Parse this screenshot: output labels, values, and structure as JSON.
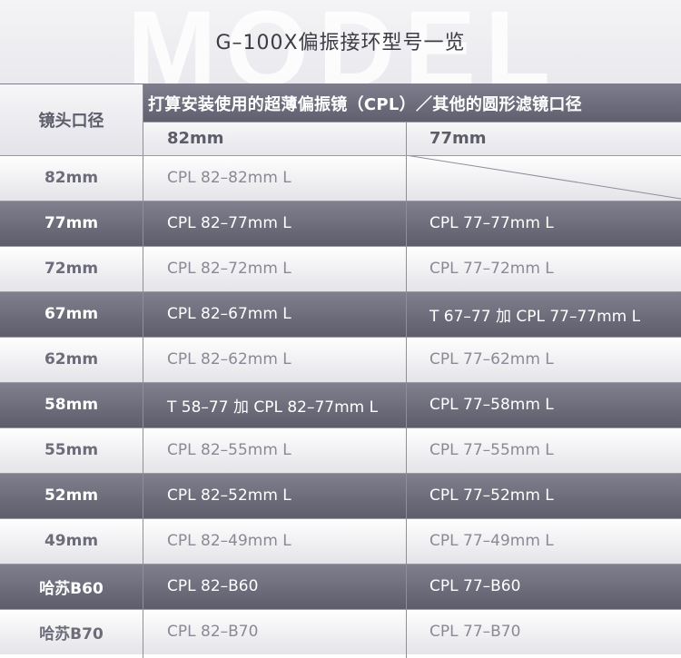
{
  "header": {
    "watermark": "MODEL",
    "title": "G–100X偏振接环型号一览"
  },
  "columns": {
    "lens_diameter": "镜头口径",
    "cpl_heading": "打算安装使用的超薄偏振镜（CPL）／其他的圆形滤镜口径",
    "size_82": "82mm",
    "size_77": "77mm"
  },
  "rows": [
    {
      "size": "82mm",
      "cpl82": "CPL 82–82mm L",
      "cpl77": "",
      "shade": "light"
    },
    {
      "size": "77mm",
      "cpl82": "CPL 82–77mm L",
      "cpl77": "CPL 77–77mm L",
      "shade": "dark"
    },
    {
      "size": "72mm",
      "cpl82": "CPL 82–72mm L",
      "cpl77": "CPL 77–72mm L",
      "shade": "light"
    },
    {
      "size": "67mm",
      "cpl82": "CPL 82–67mm L",
      "cpl77": "T 67–77 加 CPL 77–77mm L",
      "shade": "dark"
    },
    {
      "size": "62mm",
      "cpl82": "CPL 82–62mm L",
      "cpl77": "CPL 77–62mm L",
      "shade": "light"
    },
    {
      "size": "58mm",
      "cpl82": "T 58–77 加 CPL 82–77mm L",
      "cpl77": "CPL 77–58mm L",
      "shade": "dark"
    },
    {
      "size": "55mm",
      "cpl82": "CPL 82–55mm L",
      "cpl77": "CPL 77–55mm L",
      "shade": "light"
    },
    {
      "size": "52mm",
      "cpl82": "CPL 82–52mm L",
      "cpl77": "CPL 77–52mm L",
      "shade": "dark"
    },
    {
      "size": "49mm",
      "cpl82": "CPL 82–49mm L",
      "cpl77": "CPL 77–49mm L",
      "shade": "light"
    },
    {
      "size": "哈苏B60",
      "cpl82": "CPL 82–B60",
      "cpl77": "CPL 77–B60",
      "shade": "dark"
    },
    {
      "size": "哈苏B70",
      "cpl82": "CPL 82–B70",
      "cpl77": "CPL 77–B70",
      "shade": "light"
    }
  ],
  "colors": {
    "dark_row": "#6e6e7d",
    "light_row": "#f2f2f5",
    "header_band": "#6a6a79"
  }
}
